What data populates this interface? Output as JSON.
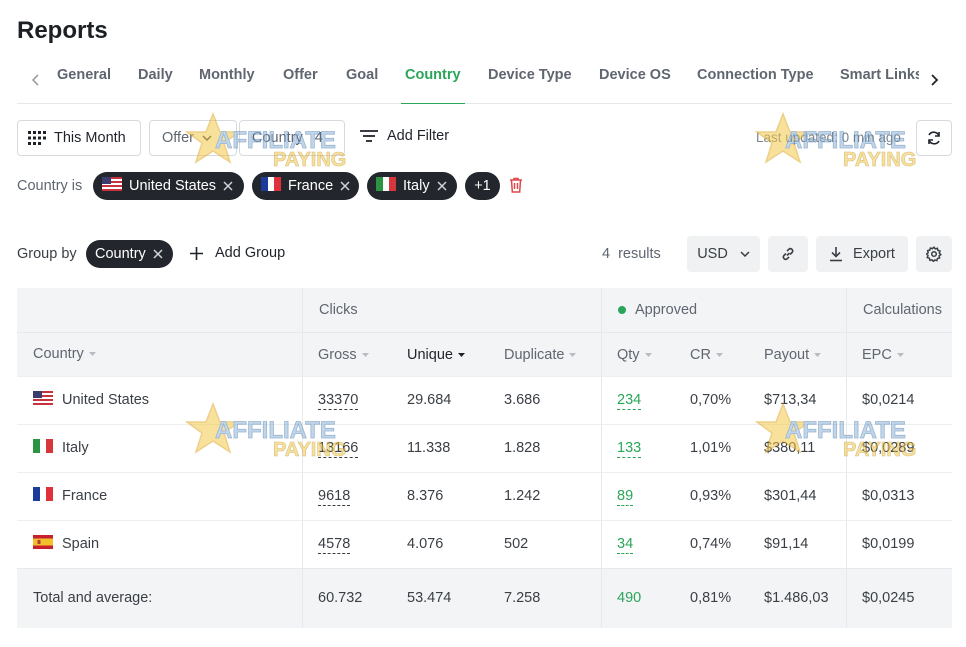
{
  "page": {
    "title": "Reports"
  },
  "tabs": [
    {
      "label": "General"
    },
    {
      "label": "Daily"
    },
    {
      "label": "Monthly"
    },
    {
      "label": "Offer"
    },
    {
      "label": "Goal"
    },
    {
      "label": "Country",
      "active": true
    },
    {
      "label": "Device Type"
    },
    {
      "label": "Device OS"
    },
    {
      "label": "Connection Type"
    },
    {
      "label": "Smart Links"
    }
  ],
  "filters": {
    "date_range": "This Month",
    "offer_label": "Offer",
    "country_label": "Country",
    "country_count": "4",
    "add_filter": "Add Filter",
    "last_updated": "Last updated: 0 min ago"
  },
  "country_filter": {
    "label": "Country is",
    "chips": [
      "United States",
      "France",
      "Italy"
    ],
    "more": "+1"
  },
  "grouping": {
    "label": "Group by",
    "chip": "Country",
    "add_group": "Add Group",
    "results": "4 results",
    "currency": "USD",
    "export": "Export"
  },
  "table": {
    "group_headers": {
      "clicks": "Clicks",
      "approved": "Approved",
      "calculations": "Calculations"
    },
    "columns": {
      "country": "Country",
      "gross": "Gross",
      "unique": "Unique",
      "duplicate": "Duplicate",
      "qty": "Qty",
      "cr": "CR",
      "payout": "Payout",
      "epc": "EPC"
    },
    "rows": [
      {
        "country": "United States",
        "gross": "33370",
        "unique": "29.684",
        "duplicate": "3.686",
        "qty": "234",
        "cr": "0,70%",
        "payout": "$713,34",
        "epc": "$0,0214"
      },
      {
        "country": "Italy",
        "gross": "13166",
        "unique": "11.338",
        "duplicate": "1.828",
        "qty": "133",
        "cr": "1,01%",
        "payout": "$380,11",
        "epc": "$0,0289"
      },
      {
        "country": "France",
        "gross": "9618",
        "unique": "8.376",
        "duplicate": "1.242",
        "qty": "89",
        "cr": "0,93%",
        "payout": "$301,44",
        "epc": "$0,0313"
      },
      {
        "country": "Spain",
        "gross": "4578",
        "unique": "4.076",
        "duplicate": "502",
        "qty": "34",
        "cr": "0,74%",
        "payout": "$91,14",
        "epc": "$0,0199"
      }
    ],
    "total": {
      "label": "Total and average:",
      "gross": "60.732",
      "unique": "53.474",
      "duplicate": "7.258",
      "qty": "490",
      "cr": "0,81%",
      "payout": "$1.486,03",
      "epc": "$0,0245"
    }
  },
  "watermark": {
    "line1": "AFFILIATE",
    "line2": "PAYING"
  },
  "colors": {
    "accent": "#2aa55a",
    "chip_bg": "#23272d",
    "header_bg": "#f3f4f6",
    "danger": "#e0474c"
  }
}
